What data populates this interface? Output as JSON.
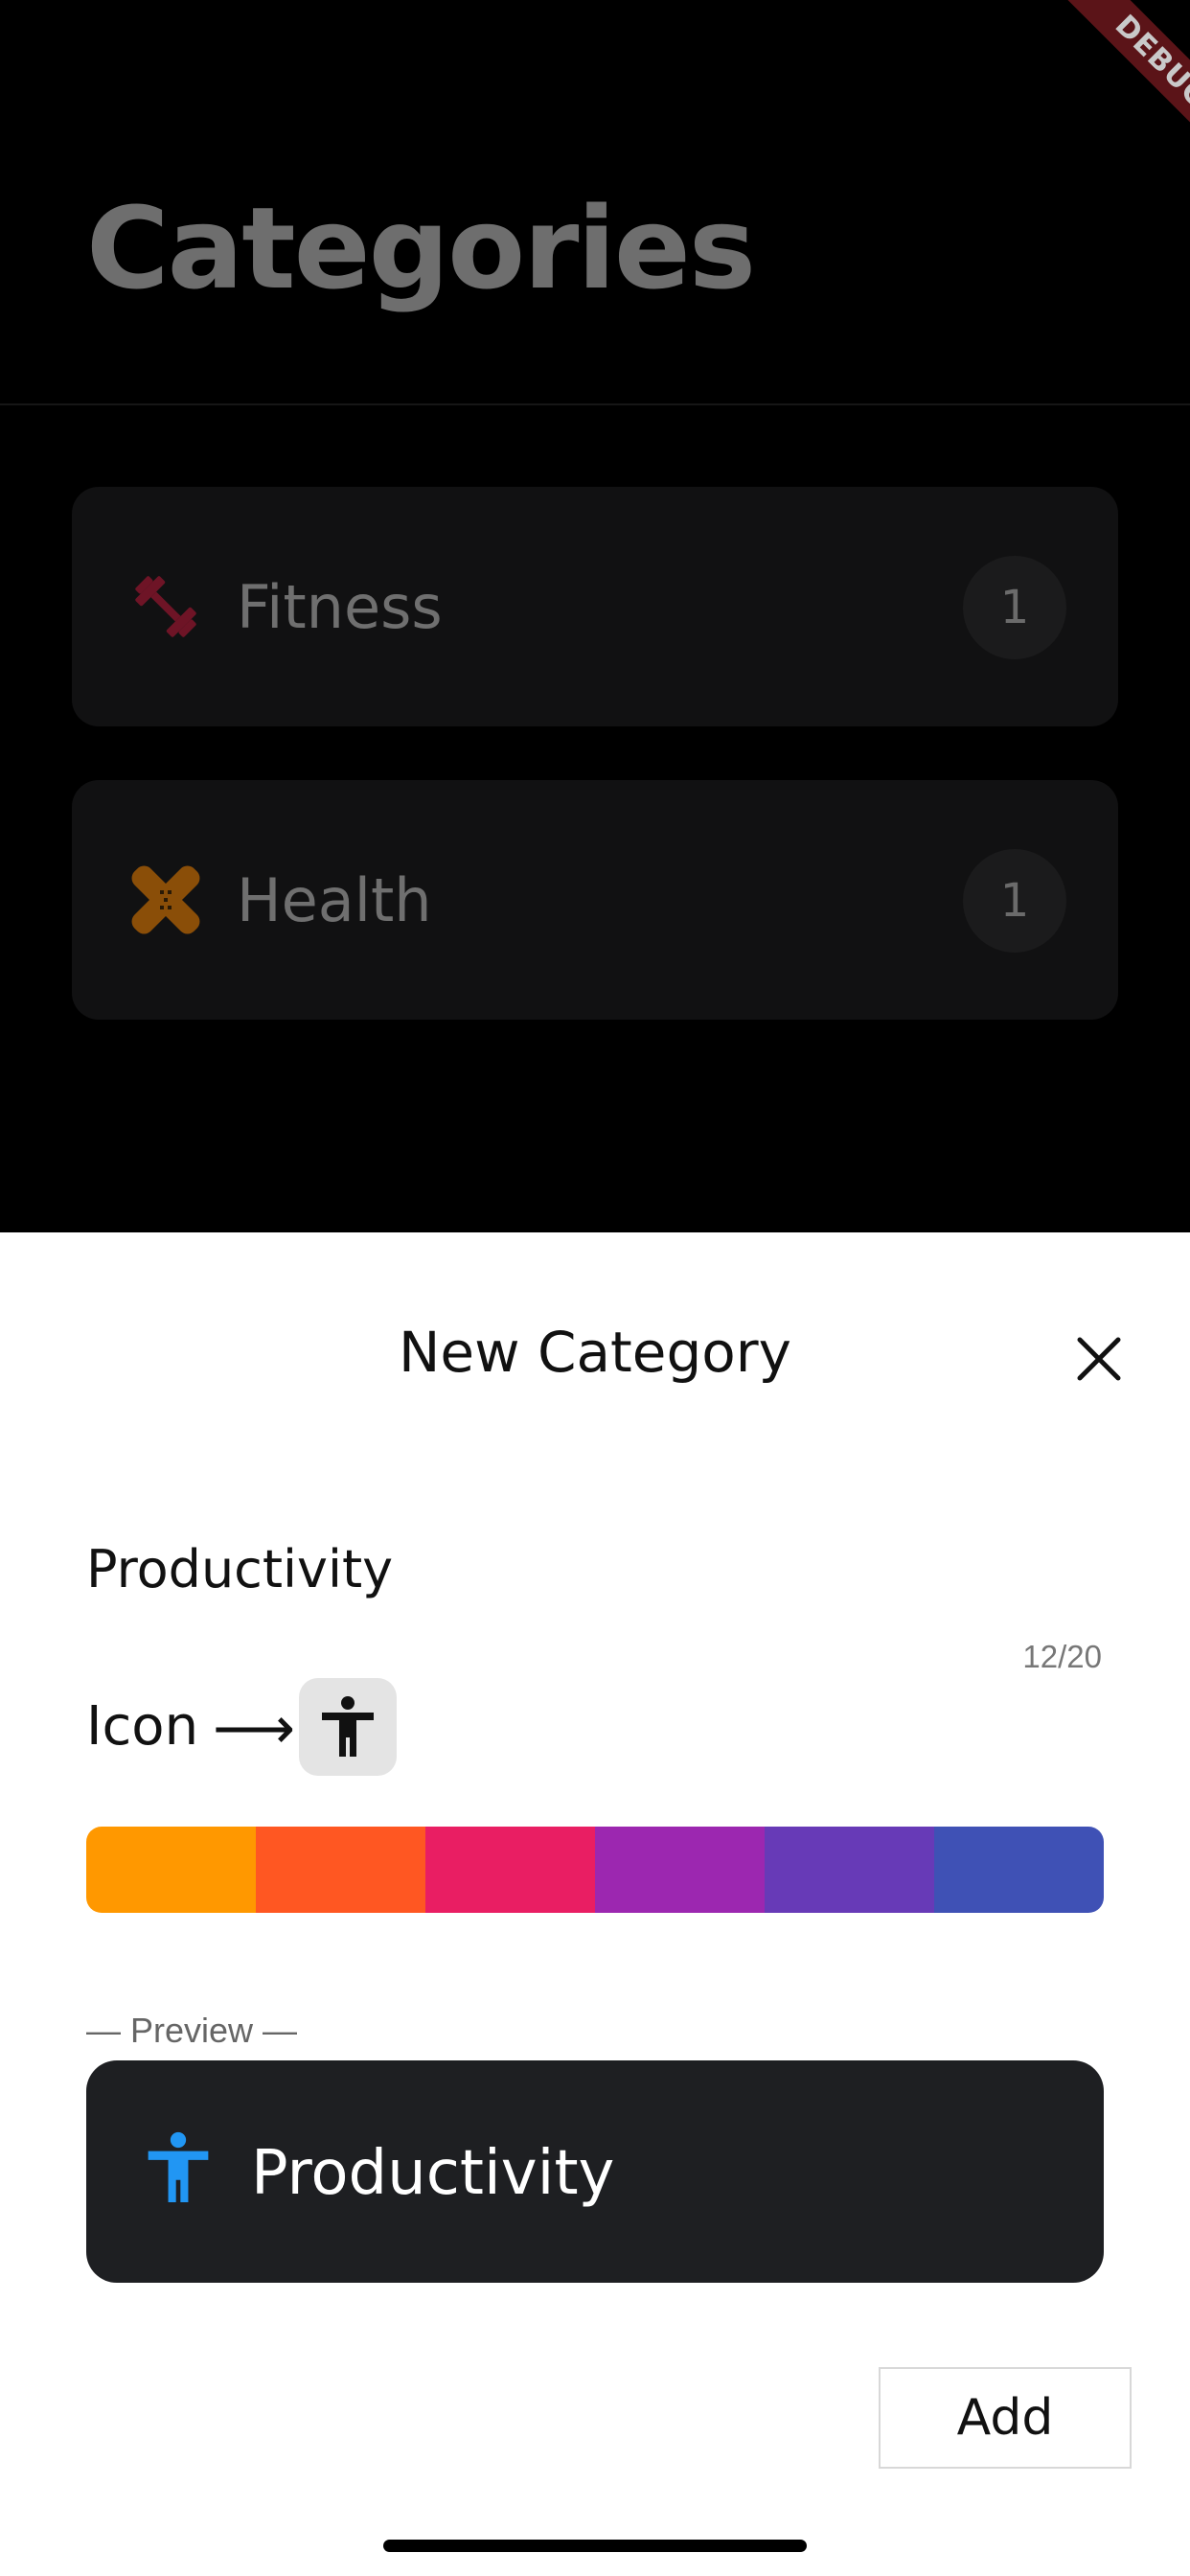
{
  "background_screen": {
    "title": "Categories",
    "debug_banner": "DEBUG",
    "categories": [
      {
        "label": "Fitness",
        "count": "1",
        "icon": "dumbbell-icon",
        "icon_color": "#6e1426"
      },
      {
        "label": "Health",
        "count": "1",
        "icon": "bandage-icon",
        "icon_color": "#8a4e08"
      }
    ]
  },
  "sheet": {
    "title": "New Category",
    "close_icon": "close-icon",
    "name_value": "Productivity",
    "char_counter": "12/20",
    "icon_label": "Icon",
    "arrow": "⟶",
    "selected_icon": "accessibility-icon",
    "colors": [
      "#FF9800",
      "#FF5722",
      "#E91E63",
      "#9C27B0",
      "#673AB7",
      "#3F51B5"
    ],
    "preview_label": "— Preview —",
    "preview": {
      "name": "Productivity",
      "icon": "accessibility-icon",
      "icon_color": "#2196F3"
    },
    "add_button": "Add"
  }
}
